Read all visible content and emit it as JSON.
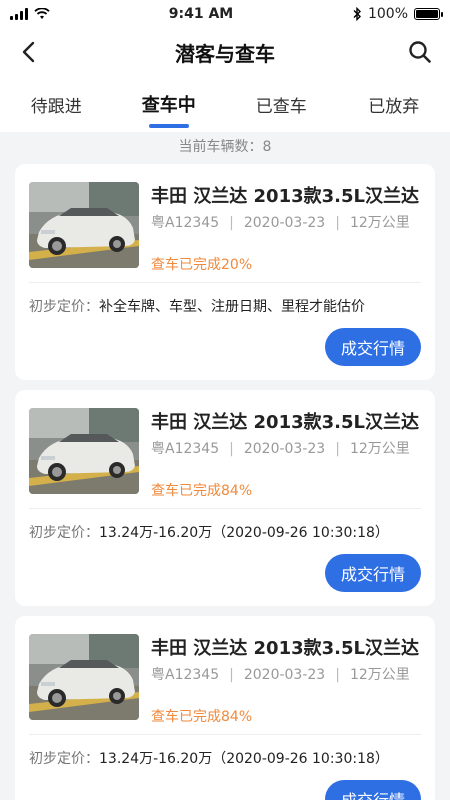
{
  "status_bar": {
    "time": "9:41 AM",
    "battery": "100%"
  },
  "nav": {
    "title": "潜客与查车",
    "back_icon": "chevron-left-icon",
    "search_icon": "search-icon"
  },
  "tabs": [
    {
      "label": "待跟进",
      "active": false
    },
    {
      "label": "查车中",
      "active": true
    },
    {
      "label": "已查车",
      "active": false
    },
    {
      "label": "已放弃",
      "active": false
    }
  ],
  "count_line": "当前车辆数：8",
  "colors": {
    "accent": "#2f6fe4",
    "progress": "#f08a3c"
  },
  "cards": [
    {
      "name": "丰田 汉兰达 2013款3.5L汉兰达",
      "plate": "粤A12345",
      "date": "2020-03-23",
      "mileage": "12万公里",
      "progress": "查车已完成20%",
      "price_label": "初步定价：",
      "price_value": "补全车牌、车型、注册日期、里程才能估价",
      "button": "成交行情"
    },
    {
      "name": "丰田 汉兰达 2013款3.5L汉兰达",
      "plate": "粤A12345",
      "date": "2020-03-23",
      "mileage": "12万公里",
      "progress": "查车已完成84%",
      "price_label": "初步定价：",
      "price_value": "13.24万-16.20万（2020-09-26 10:30:18）",
      "button": "成交行情"
    },
    {
      "name": "丰田 汉兰达 2013款3.5L汉兰达",
      "plate": "粤A12345",
      "date": "2020-03-23",
      "mileage": "12万公里",
      "progress": "查车已完成84%",
      "price_label": "初步定价：",
      "price_value": "13.24万-16.20万（2020-09-26 10:30:18）",
      "button": "成交行情"
    }
  ]
}
